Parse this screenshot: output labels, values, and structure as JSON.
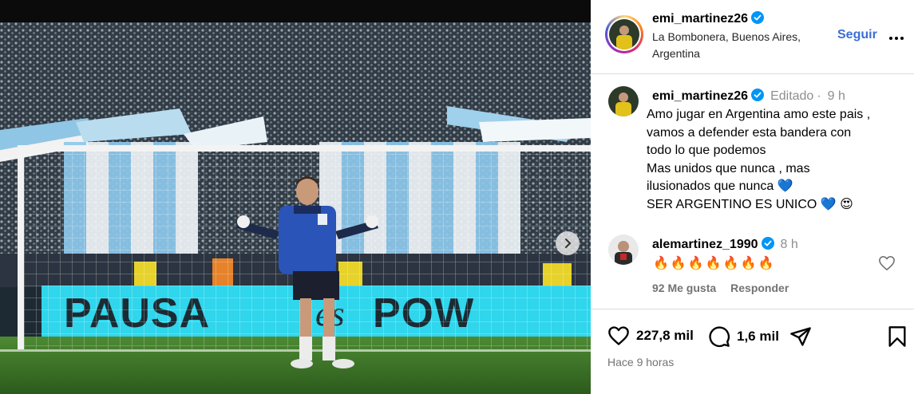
{
  "post": {
    "username": "emi_martinez26",
    "location": "La Bombonera, Buenos Aires, Argentina",
    "follow_label": "Seguir",
    "banner_text": "PAUSA es POW"
  },
  "caption": {
    "username": "emi_martinez26",
    "edited": "Editado",
    "time": "9 h",
    "lines": [
      "Amo jugar en Argentina amo este pais ,",
      "vamos a defender esta bandera con",
      "todo lo que podemos",
      "Mas unidos que nunca , mas",
      "ilusionados que nunca 💙",
      "SER ARGENTINO ES UNICO 💙 😍"
    ]
  },
  "comment": {
    "username": "alemartinez_1990",
    "time": "8 h",
    "text": "🔥🔥🔥🔥🔥🔥🔥",
    "likes": "92 Me gusta",
    "reply_label": "Responder"
  },
  "actions": {
    "likes": "227,8 mil",
    "comments": "1,6 mil",
    "posted": "Hace 9 horas"
  },
  "icons": {
    "verified": "verified-badge-icon",
    "more": "more-options-icon",
    "like": "heart-icon",
    "comment": "comment-icon",
    "share": "share-icon",
    "save": "bookmark-icon",
    "next": "chevron-right-icon"
  },
  "colors": {
    "accent": "#3b6fd4",
    "verified": "#0095f6",
    "banner": "#2fd6ec",
    "jersey": "#2a54b8"
  }
}
